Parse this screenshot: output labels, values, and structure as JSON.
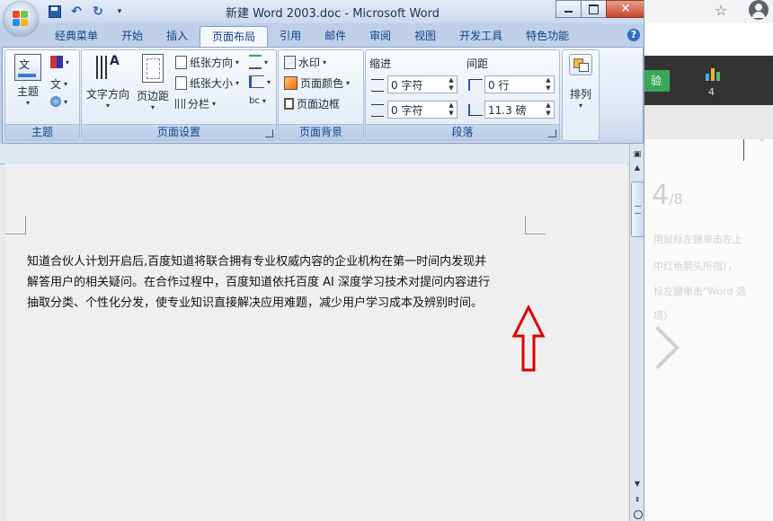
{
  "window": {
    "title": "新建 Word 2003.doc - Microsoft Word",
    "close_label": "×"
  },
  "tabs": [
    "经典菜单",
    "开始",
    "插入",
    "页面布局",
    "引用",
    "邮件",
    "审阅",
    "视图",
    "开发工具",
    "特色功能"
  ],
  "active_tab": "页面布局",
  "help_label": "?",
  "ribbon": {
    "theme_group": {
      "label": "主题",
      "theme_button": "主题"
    },
    "page_setup_group": {
      "label": "页面设置",
      "text_direction": "文字方向",
      "margins": "页边距",
      "orientation": "纸张方向",
      "size": "纸张大小",
      "columns": "分栏"
    },
    "page_background_group": {
      "label": "页面背景",
      "watermark": "水印",
      "page_color": "页面颜色",
      "page_borders": "页面边框"
    },
    "paragraph_group": {
      "label": "段落",
      "indent_label": "缩进",
      "spacing_label": "间距",
      "indent_left": "0 字符",
      "indent_right": "0 字符",
      "spacing_before": "0 行",
      "spacing_after": "11.3 磅"
    },
    "arrange_group": {
      "arrange": "排列"
    }
  },
  "document": {
    "lines": [
      "知道合伙人计划开启后,百度知道将联合拥有专业权威内容的企业机构在第一时间内发现并",
      "解答用户的相关疑问。在合作过程中，百度知道依托百度 AI 深度学习技术对提问内容进行",
      "抽取分类、个性化分发，使专业知识直接解决应用难题，减少用户学习成本及辨别时间。"
    ]
  },
  "background_browser": {
    "green_button": "验",
    "count": "4",
    "big_number": "4",
    "big_suffix": "/8",
    "lines": [
      "用鼠标左键单击左上",
      "中红色箭头所指），",
      "标左键单击\"Word 选",
      "项）"
    ]
  },
  "colors": {
    "accent": "#15428b",
    "arrow": "#e00000",
    "ribbon": "#dbe6f4"
  }
}
